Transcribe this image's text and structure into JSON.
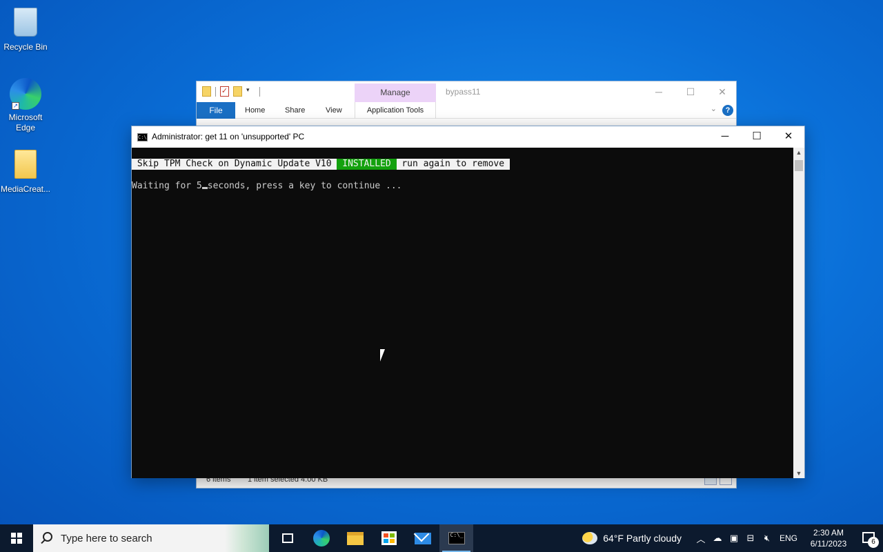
{
  "desktop": {
    "icons": [
      {
        "label": "Recycle Bin"
      },
      {
        "label": "Microsoft Edge"
      },
      {
        "label": "MediaCreat..."
      }
    ]
  },
  "explorer": {
    "contextual_tab": "Manage",
    "title": "bypass11",
    "ribbon": {
      "file": "File",
      "home": "Home",
      "share": "Share",
      "view": "View",
      "app_tools": "Application Tools"
    },
    "status": {
      "items": "6 items",
      "selected": "1 item selected  4.00 KB"
    },
    "help_label": "?"
  },
  "console": {
    "title": "Administrator:  get 11 on 'unsupported' PC",
    "banner": {
      "left": " Skip TPM Check on Dynamic Update V10 ",
      "status": " INSTALLED ",
      "right": " run again to remove "
    },
    "line2_before": "Waiting for 5",
    "line2_after": "seconds, press a key to continue ..."
  },
  "taskbar": {
    "search_placeholder": "Type here to search",
    "weather": "64°F  Partly cloudy",
    "language": "ENG",
    "time": "2:30 AM",
    "date": "6/11/2023",
    "notification_count": "6"
  },
  "colors": {
    "console_bg": "#0c0c0c",
    "console_fg": "#cccccc",
    "installed_green": "#13a10e",
    "taskbar_bg": "#0c1a2e",
    "manage_tab": "#ecd3f8",
    "file_tab": "#1a6fc4"
  }
}
